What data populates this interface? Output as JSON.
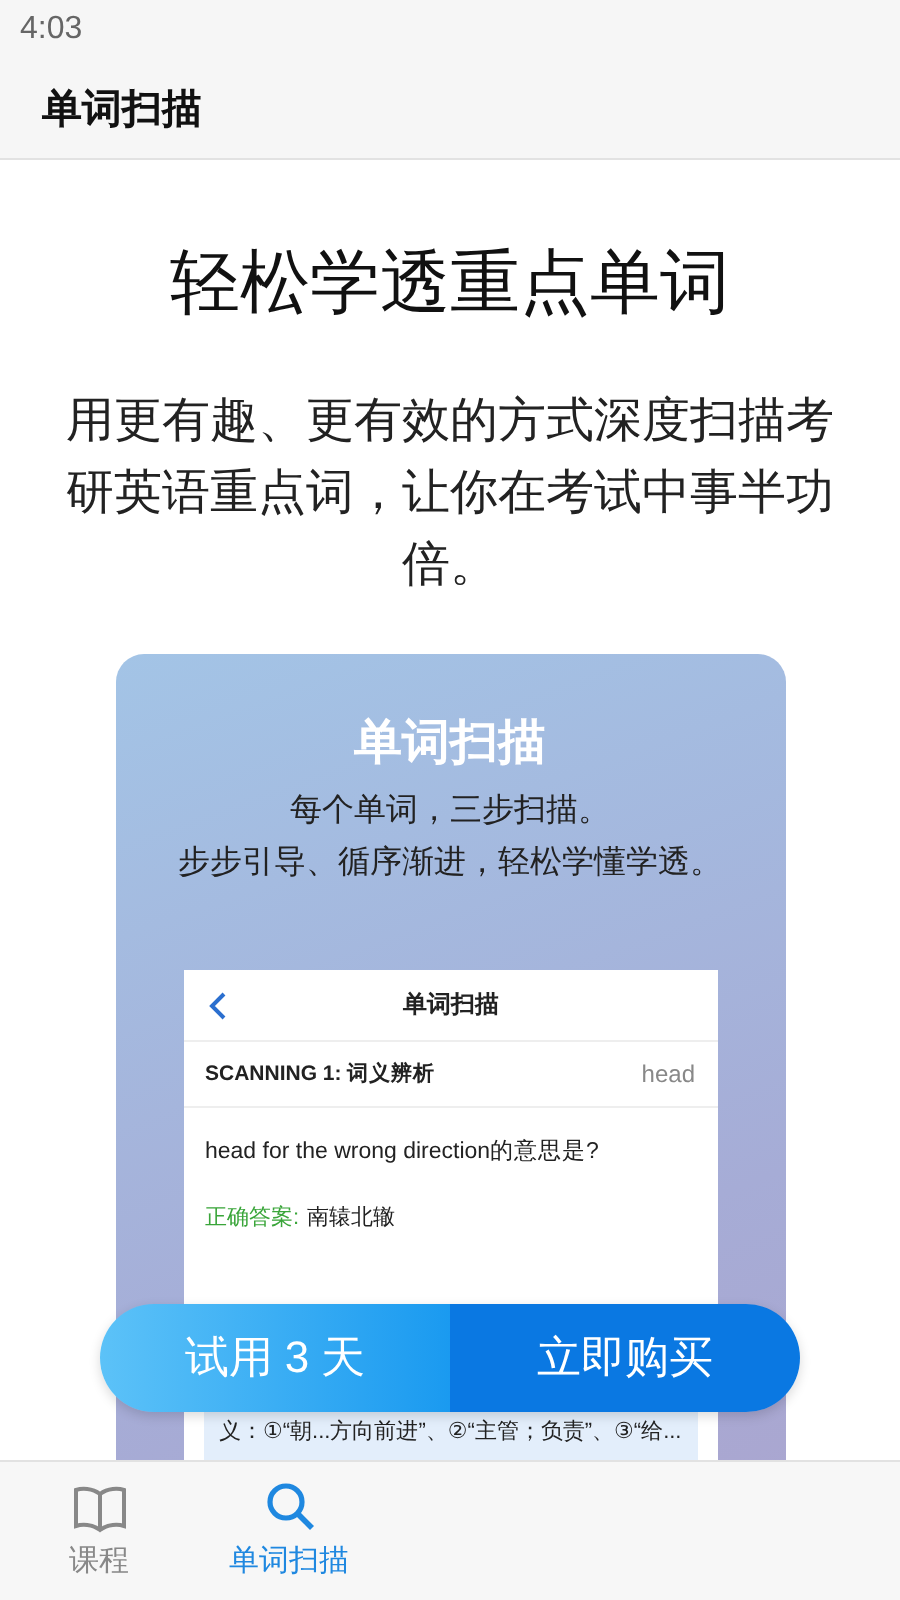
{
  "status_bar": {
    "time": "4:03"
  },
  "header": {
    "title": "单词扫描"
  },
  "hero": {
    "heading": "轻松学透重点单词",
    "description": "用更有趣、更有效的方式深度扫描考研英语重点词，让你在考试中事半功倍。"
  },
  "promo_card": {
    "title": "单词扫描",
    "lines": [
      "每个单词，三步扫描。",
      "步步引导、循序渐进，轻松学懂学透。"
    ],
    "preview": {
      "title": "单词扫描",
      "section": "SCANNING 1: 词义辨析",
      "word": "head",
      "question": "head for the wrong direction的意思是?",
      "answer_label": "正确答案:",
      "answer": "南辕北辙",
      "explanation": "义：①“朝...方向前进”、②“主管；负责”、③“给..."
    }
  },
  "actions": [
    {
      "label": "试用 3 天",
      "kind": "trial"
    },
    {
      "label": "立即购买",
      "kind": "buy"
    }
  ],
  "tab_bar": [
    {
      "label": "课程",
      "kind": "book",
      "selected": false
    },
    {
      "label": "单词扫描",
      "kind": "search",
      "selected": true
    }
  ]
}
